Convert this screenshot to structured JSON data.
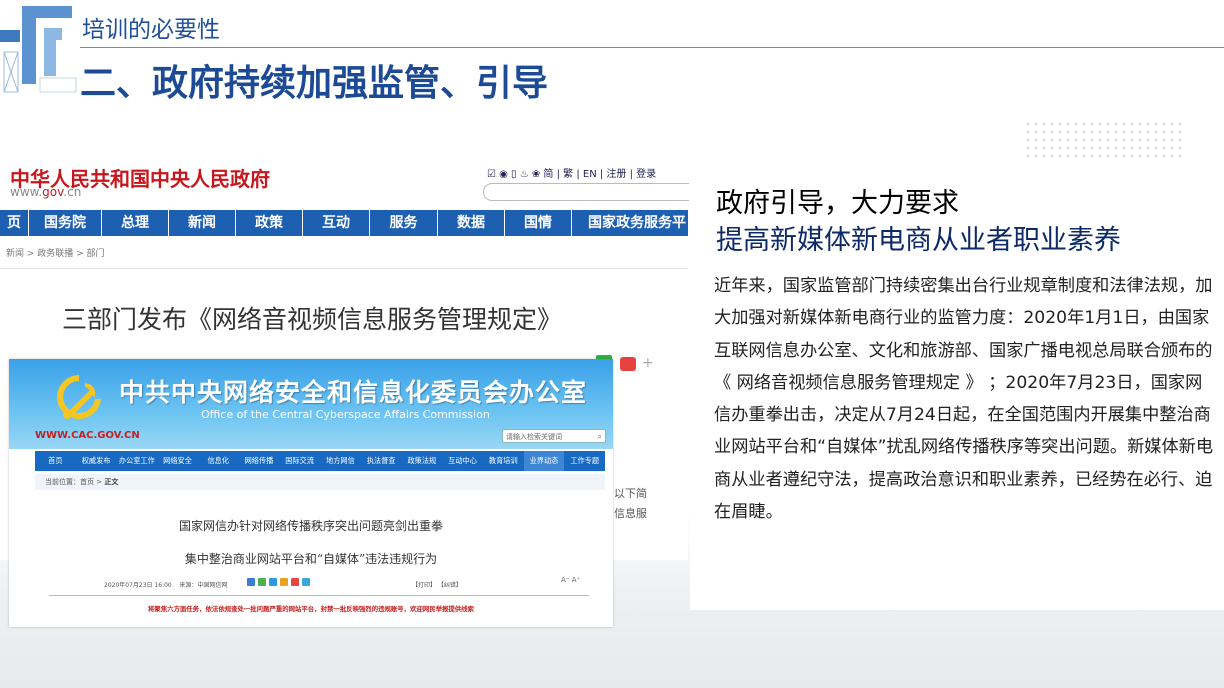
{
  "header": {
    "subtitle": "培训的必要性",
    "title": "二、政府持续加强监管、引导"
  },
  "gov_site": {
    "name": "中华人民共和国中央人民政府",
    "url_prefix": "www.",
    "url_domain": "gov",
    "url_suffix": ".cn",
    "tools": "☑ ◉ ▯ ♨ ❀  简 | 繁 | EN | 注册 | 登录",
    "nav": [
      "页",
      "国务院",
      "总理",
      "新闻",
      "政策",
      "互动",
      "服务",
      "数据",
      "国情",
      "国家政务服务平"
    ],
    "breadcrumb": "新闻  >  政务联播  >  部门",
    "headline": "三部门发布《网络音视频信息服务管理规定》",
    "share_plus": "+",
    "side_text_line1": "以下简",
    "side_text_line2": "信息服"
  },
  "cac_site": {
    "title": "中共中央网络安全和信息化委员会办公室",
    "title_en": "Office of the Central Cyberspace Affairs Commission",
    "url": "WWW.CAC.GOV.CN",
    "search_placeholder": "请输入检索关键词",
    "search_icon": "search-icon",
    "nav": [
      "首页",
      "权威发布",
      "办公室工作",
      "网络安全",
      "信息化",
      "网络传播",
      "国际交流",
      "地方网信",
      "执法督查",
      "政策法规",
      "互动中心",
      "教育培训",
      "业界动态",
      "工作专题"
    ],
    "nav_active_index": 12,
    "breadcrumb_prefix": "当前位置：首页 > ",
    "breadcrumb_current": "正文",
    "headline1": "国家网信办针对网络传播秩序突出问题亮剑出重拳",
    "headline2": "集中整治商业网站平台和“自媒体”违法违规行为",
    "date": "2020年07月23日 16:00",
    "source": "来源：中国网信网",
    "print_links": "【打印】 【纠错】",
    "font_size": "A⁻ A⁺",
    "note": "将聚焦六方面任务，依法依规查处一批问题严重的网站平台，封禁一批反映强烈的违规账号，欢迎网民举报提供线索"
  },
  "panel": {
    "heading_line1": "政府引导，大力要求",
    "heading_line2": "提高新媒体新电商从业者职业素养",
    "body": "近年来，国家监管部门持续密集出台行业规章制度和法律法规，加大加强对新媒体新电商行业的监管力度：2020年1月1日，由国家互联网信息办公室、文化和旅游部、国家广播电视总局联合颁布的 《 网络音视频信息服务管理规定 》 ；2020年7月23日，国家网信办重拳出击，决定从7月24日起，在全国范围内开展集中整治商业网站平台和“自媒体”扰乱网络传播秩序等突出问题。新媒体新电商从业者遵纪守法，提高政治意识和职业素养，已经势在必行、迫在眉睫。"
  },
  "colors": {
    "title_blue": "#1c4a95",
    "gov_red": "#c8161d",
    "gov_nav_blue": "#1d5fb1",
    "cac_nav_blue": "#1769c2"
  }
}
